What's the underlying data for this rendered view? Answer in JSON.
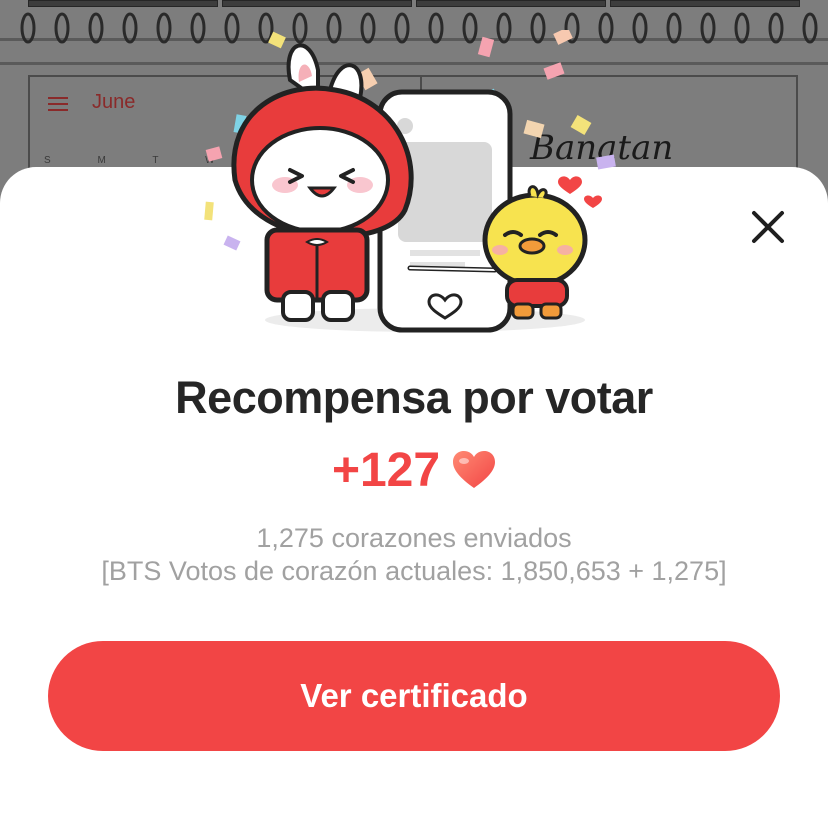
{
  "background": {
    "calendar_month": "June",
    "weekday_letters": [
      "S",
      "M",
      "T",
      "W"
    ],
    "banner_text": "Banatan"
  },
  "modal": {
    "close_icon": "close-icon",
    "title": "Recompensa por votar",
    "reward_amount": "+127",
    "reward_icon": "heart-icon",
    "hearts_sent": "1,275 corazones enviados",
    "current_votes": "[BTS Votos de corazón actuales: 1,850,653 + 1,275]",
    "cta_label": "Ver certificado"
  },
  "colors": {
    "accent": "#f24545",
    "title_text": "#262626",
    "secondary_text": "#a1a1a1",
    "sheet_background": "#ffffff",
    "dim_overlay": "#7d7d7d"
  }
}
